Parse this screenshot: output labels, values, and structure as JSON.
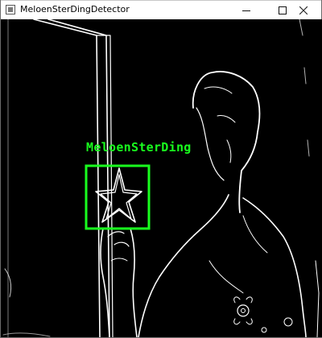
{
  "window": {
    "title": "MeloenSterDingDetector",
    "controls": [
      "minimize-icon",
      "maximize-icon",
      "close-icon"
    ]
  },
  "detection": {
    "label": "MeloenSterDing",
    "box_color": "#19ff1e",
    "label_color": "#19ff1e"
  },
  "frame": {
    "background": "#000000",
    "edge_color": "#ffffff"
  }
}
